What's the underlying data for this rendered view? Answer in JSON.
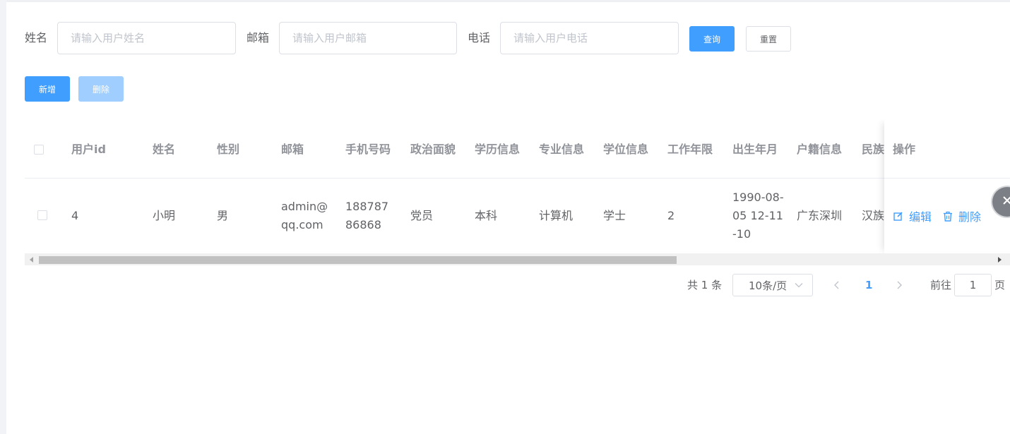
{
  "search": {
    "name_label": "姓名",
    "name_placeholder": "请输入用户姓名",
    "email_label": "邮箱",
    "email_placeholder": "请输入用户邮箱",
    "phone_label": "电话",
    "phone_placeholder": "请输入用户电话",
    "query_label": "查询",
    "reset_label": "重置"
  },
  "toolbar": {
    "add_label": "新增",
    "delete_label": "删除"
  },
  "table": {
    "columns": [
      "用户id",
      "姓名",
      "性别",
      "邮箱",
      "手机号码",
      "政治面貌",
      "学历信息",
      "专业信息",
      "学位信息",
      "工作年限",
      "出生年月",
      "户籍信息",
      "民族",
      "操作"
    ],
    "rows": [
      {
        "id": "4",
        "name": "小明",
        "gender": "男",
        "email": "admin@qq.com",
        "phone": "18878786868",
        "political": "党员",
        "education": "本科",
        "major": "计算机",
        "degree": "学士",
        "work_years": "2",
        "birth": "1990-08-05 12-11-10",
        "hukou": "广东深圳",
        "ethnicity": "汉族",
        "edit_label": "编辑",
        "delete_label": "删除"
      }
    ]
  },
  "pagination": {
    "total_text": "共 1 条",
    "page_size": "10条/页",
    "current_page": "1",
    "goto_label": "前往",
    "goto_value": "1",
    "page_unit": "页"
  },
  "colors": {
    "primary": "#409eff",
    "primary_disabled": "#a0cfff",
    "header_text": "#909399",
    "body_text": "#606266",
    "border": "#dcdfe6"
  },
  "icons": [
    "edit-icon",
    "delete-icon",
    "chevron-down-icon",
    "chevron-left-icon",
    "chevron-right-icon",
    "close-icon"
  ]
}
